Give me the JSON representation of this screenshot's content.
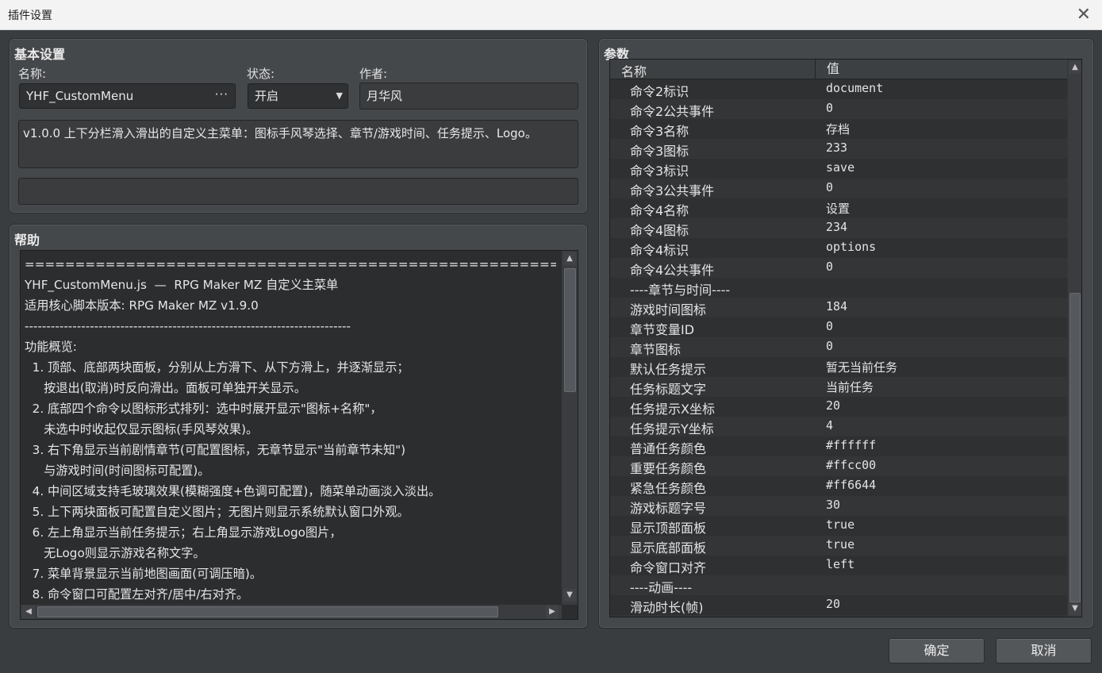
{
  "window": {
    "title": "插件设置"
  },
  "basic": {
    "title": "基本设置",
    "name_label": "名称:",
    "name_value": "YHF_CustomMenu",
    "status_label": "状态:",
    "status_value": "开启",
    "author_label": "作者:",
    "author_value": "月华风",
    "description": "v1.0.0 上下分栏滑入滑出的自定义主菜单：图标手风琴选择、章节/游戏时间、任务提示、Logo。",
    "extra_value": ""
  },
  "help": {
    "title": "帮助",
    "lines": [
      "===========================================================================",
      "YHF_CustomMenu.js  —  RPG Maker MZ 自定义主菜单",
      "适用核心脚本版本: RPG Maker MZ v1.9.0",
      "---------------------------------------------------------------------------",
      "功能概览:",
      "  1. 顶部、底部两块面板，分别从上方滑下、从下方滑上，并逐渐显示；",
      "     按退出(取消)时反向滑出。面板可单独开关显示。",
      "  2. 底部四个命令以图标形式排列：选中时展开显示\"图标+名称\"，",
      "     未选中时收起仅显示图标(手风琴效果)。",
      "  3. 右下角显示当前剧情章节(可配置图标，无章节显示\"当前章节未知\")",
      "     与游戏时间(时间图标可配置)。",
      "  4. 中间区域支持毛玻璃效果(模糊强度+色调可配置)，随菜单动画淡入淡出。",
      "  5. 上下两块面板可配置自定义图片；无图片则显示系统默认窗口外观。",
      "  6. 左上角显示当前任务提示；右上角显示游戏Logo图片，",
      "     无Logo则显示游戏名称文字。",
      "  7. 菜单背景显示当前地图画面(可调压暗)。",
      "  8. 命令窗口可配置左对齐/居中/右对齐。"
    ]
  },
  "params": {
    "title": "参数",
    "col_name": "名称",
    "col_value": "值",
    "rows": [
      {
        "name": "命令2标识",
        "value": "document"
      },
      {
        "name": "命令2公共事件",
        "value": "0"
      },
      {
        "name": "命令3名称",
        "value": "存档"
      },
      {
        "name": "命令3图标",
        "value": "233"
      },
      {
        "name": "命令3标识",
        "value": "save"
      },
      {
        "name": "命令3公共事件",
        "value": "0"
      },
      {
        "name": "命令4名称",
        "value": "设置"
      },
      {
        "name": "命令4图标",
        "value": "234"
      },
      {
        "name": "命令4标识",
        "value": "options"
      },
      {
        "name": "命令4公共事件",
        "value": "0"
      },
      {
        "name": "----章节与时间----",
        "value": ""
      },
      {
        "name": "游戏时间图标",
        "value": "184"
      },
      {
        "name": "章节变量ID",
        "value": "0"
      },
      {
        "name": "章节图标",
        "value": "0"
      },
      {
        "name": "默认任务提示",
        "value": "暂无当前任务"
      },
      {
        "name": "任务标题文字",
        "value": "当前任务"
      },
      {
        "name": "任务提示X坐标",
        "value": "20"
      },
      {
        "name": "任务提示Y坐标",
        "value": "4"
      },
      {
        "name": "普通任务颜色",
        "value": "#ffffff"
      },
      {
        "name": "重要任务颜色",
        "value": "#ffcc00"
      },
      {
        "name": "紧急任务颜色",
        "value": "#ff6644"
      },
      {
        "name": "游戏标题字号",
        "value": "30"
      },
      {
        "name": "显示顶部面板",
        "value": "true"
      },
      {
        "name": "显示底部面板",
        "value": "true"
      },
      {
        "name": "命令窗口对齐",
        "value": "left"
      },
      {
        "name": "----动画----",
        "value": ""
      },
      {
        "name": "滑动时长(帧)",
        "value": "20"
      }
    ]
  },
  "buttons": {
    "ok": "确定",
    "cancel": "取消"
  },
  "icons": {
    "close": "close-icon",
    "dropdown": "chevron-down-icon",
    "browse": "ellipsis-icon"
  }
}
